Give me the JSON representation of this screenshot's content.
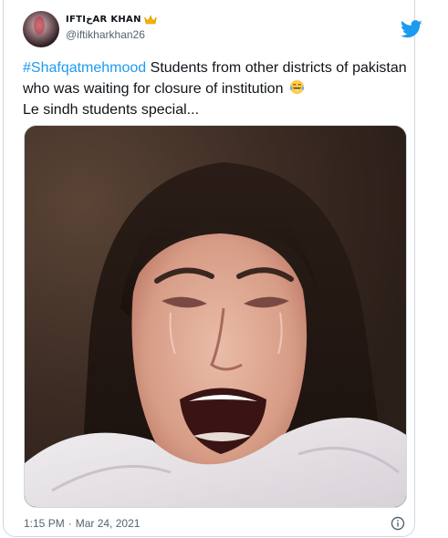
{
  "author": {
    "display_name": "IFTIخAR KHAN",
    "handle": "@iftikharkhan26",
    "avatar": "profile-photo",
    "badge": "crown-emoji"
  },
  "platform": {
    "logo": "twitter-bird-icon",
    "brand_color": "#1d9bf0"
  },
  "tweet": {
    "hashtag": "#Shafqatmehmood",
    "text_part1": " Students from other districts of pakistan who was waiting for closure of institution",
    "emoji": "face-with-tears-of-joy",
    "text_part2": "Le sindh students special..."
  },
  "media": {
    "type": "photo",
    "subject": "crying-woman-photo"
  },
  "footer": {
    "time": "1:15 PM",
    "separator": "·",
    "date": "Mar 24, 2021",
    "info_icon": "info-icon"
  },
  "colors": {
    "text": "#0f1419",
    "secondary_text": "#536471",
    "border": "#cfd9de",
    "link": "#1d9bf0"
  }
}
